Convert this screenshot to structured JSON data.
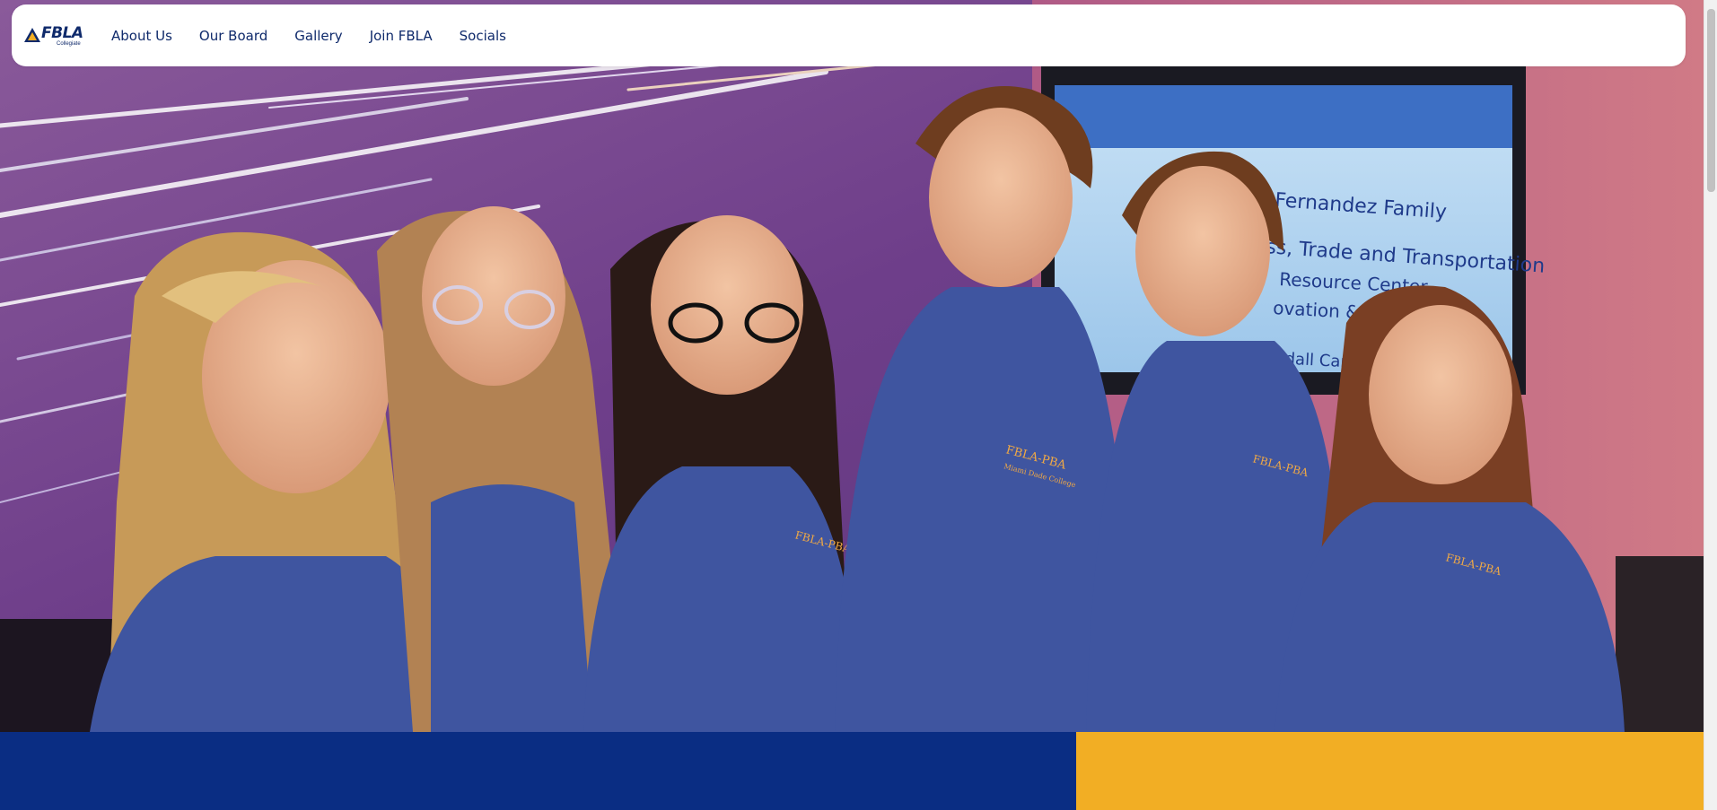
{
  "brand": {
    "name": "FBLA",
    "sub": "Collegiate"
  },
  "nav": {
    "items": [
      {
        "label": "About Us"
      },
      {
        "label": "Our Board"
      },
      {
        "label": "Gallery"
      },
      {
        "label": "Join FBLA"
      },
      {
        "label": "Socials"
      }
    ]
  },
  "hero": {
    "screen_lines": [
      "Fernandez Family",
      "ss, Trade and Transportation",
      "Resource Center",
      "ovation & Technolo",
      "ndall Campus"
    ],
    "shirt_logo": "FBLA-PBA",
    "shirt_sub": "Miami Dade College"
  },
  "colors": {
    "brand_blue": "#0a2d83",
    "brand_gold": "#f2ae24",
    "nav_text": "#0f2a6b",
    "polo": "#3f55a0"
  },
  "icons": {
    "logo": "fbla-triangle-logo-icon"
  }
}
